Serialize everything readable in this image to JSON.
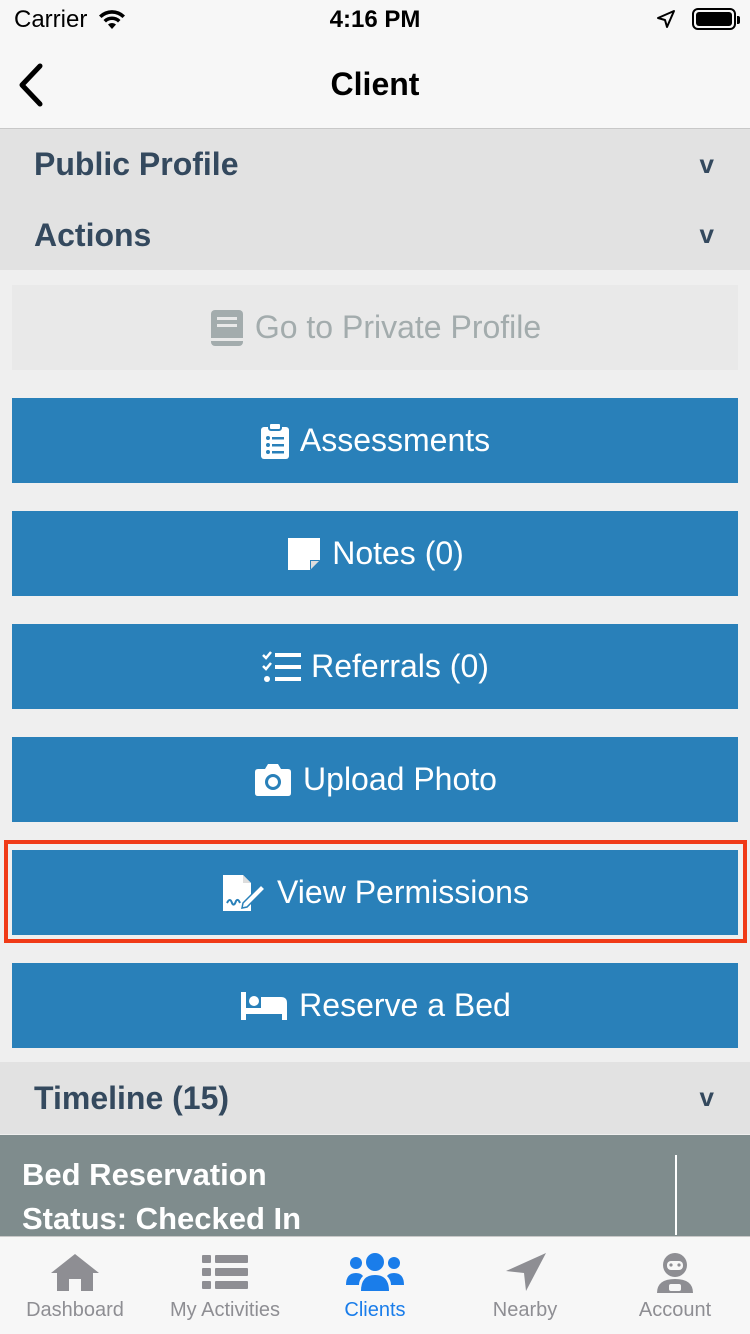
{
  "status_bar": {
    "carrier": "Carrier",
    "time": "4:16 PM"
  },
  "nav": {
    "title": "Client",
    "back_icon": "chevron-left-icon"
  },
  "sections": {
    "public_profile": "Public Profile",
    "actions": "Actions",
    "timeline": "Timeline (15)",
    "chevron": "v"
  },
  "actions": [
    {
      "label": "Go to Private Profile",
      "icon": "book-icon",
      "disabled": true
    },
    {
      "label": "Assessments",
      "icon": "clipboard-list-icon"
    },
    {
      "label": "Notes (0)",
      "icon": "sticky-note-icon"
    },
    {
      "label": "Referrals (0)",
      "icon": "tasks-icon"
    },
    {
      "label": "Upload Photo",
      "icon": "camera-icon"
    },
    {
      "label": "View Permissions",
      "icon": "file-signature-icon"
    },
    {
      "label": "Reserve a Bed",
      "icon": "bed-icon"
    }
  ],
  "timeline_card": {
    "line1": "Bed Reservation",
    "line2": "Status: Checked In"
  },
  "tabs": [
    {
      "label": "Dashboard",
      "icon": "home-icon",
      "active": false
    },
    {
      "label": "My Activities",
      "icon": "list-icon",
      "active": false
    },
    {
      "label": "Clients",
      "icon": "users-icon",
      "active": true
    },
    {
      "label": "Nearby",
      "icon": "location-arrow-icon",
      "active": false
    },
    {
      "label": "Account",
      "icon": "user-astronaut-icon",
      "active": false
    }
  ],
  "colors": {
    "primary": "#2980b9",
    "section_text": "#34495e",
    "highlight": "#f03a17",
    "active_tab": "#1a7dea",
    "timeline_bg": "#7f8c8d"
  }
}
